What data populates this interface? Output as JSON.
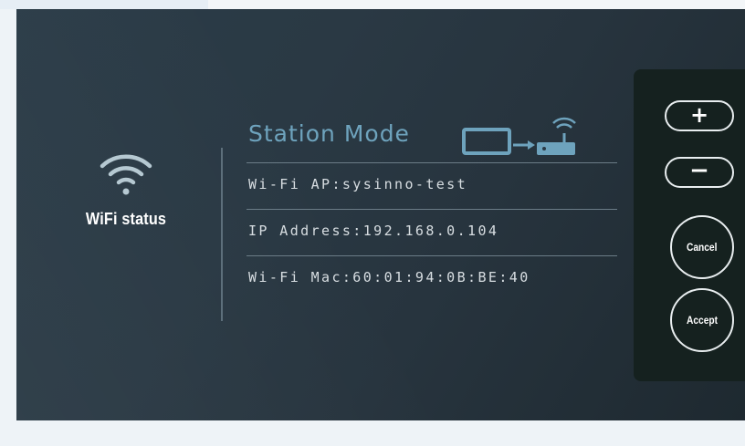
{
  "wifi_status": {
    "label": "WiFi status",
    "icon": "wifi-icon"
  },
  "station": {
    "mode_title": "Station Mode",
    "mode_icon": "monitor-to-router-icon",
    "rows": [
      {
        "text": "Wi-Fi AP:sysinno-test"
      },
      {
        "text": "IP Address:192.168.0.104"
      },
      {
        "text": "Wi-Fi Mac:60:01:94:0B:BE:40"
      }
    ]
  },
  "controls": {
    "plus_label": "+",
    "minus_label": "−",
    "cancel_label": "Cancel",
    "accept_label": "Accept"
  },
  "colors": {
    "accent": "#6ea3bd",
    "panel_bg": "#15211f",
    "screen_bg": "#2a3944",
    "text": "#d8dee2"
  }
}
